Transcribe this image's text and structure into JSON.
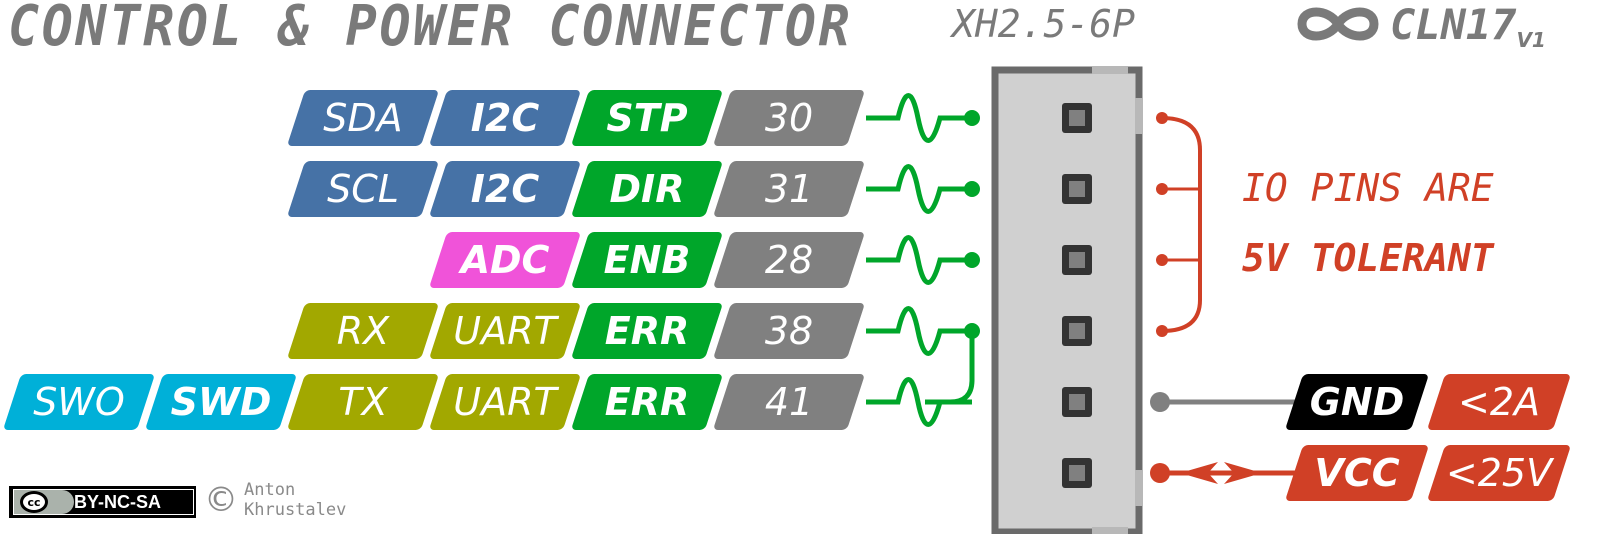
{
  "header": {
    "title": "CONTROL & POWER CONNECTOR",
    "part_number": "XH2.5-6P",
    "logo_text": "CLN17",
    "logo_version": "V1",
    "logo_icon": "infinity-icon"
  },
  "colors": {
    "i2c": "#4672a6",
    "uart": "#a2a800",
    "swd": "#00b0d8",
    "adc": "#f053d9",
    "func": "#00a62a",
    "pin": "#808080",
    "wire_signal": "#00a62a",
    "wire_gnd": "#808080",
    "power": "#d04026",
    "gnd_tag": "#000000",
    "connector_body": "#d0d0d0",
    "connector_border": "#6a6a6a",
    "text_grey": "#7a7a7a"
  },
  "pins": [
    {
      "tags": [
        "SDA",
        "I2C",
        "STP",
        "30"
      ]
    },
    {
      "tags": [
        "SCL",
        "I2C",
        "DIR",
        "31"
      ]
    },
    {
      "tags": [
        "ADC",
        "ENB",
        "28"
      ]
    },
    {
      "tags": [
        "RX",
        "UART",
        "ERR",
        "38"
      ]
    },
    {
      "tags": [
        "SWO",
        "SWD",
        "TX",
        "UART",
        "ERR",
        "41"
      ]
    }
  ],
  "power": [
    {
      "name": "GND",
      "limit": "<2A"
    },
    {
      "name": "VCC",
      "limit": "<25V"
    }
  ],
  "note": {
    "line1": "IO PINS ARE",
    "line2": "5V TOLERANT"
  },
  "footer": {
    "license": "BY-NC-SA",
    "cc_label": "cc",
    "copyright_symbol": "©",
    "author_first": "Anton",
    "author_last": "Khrustalev"
  }
}
